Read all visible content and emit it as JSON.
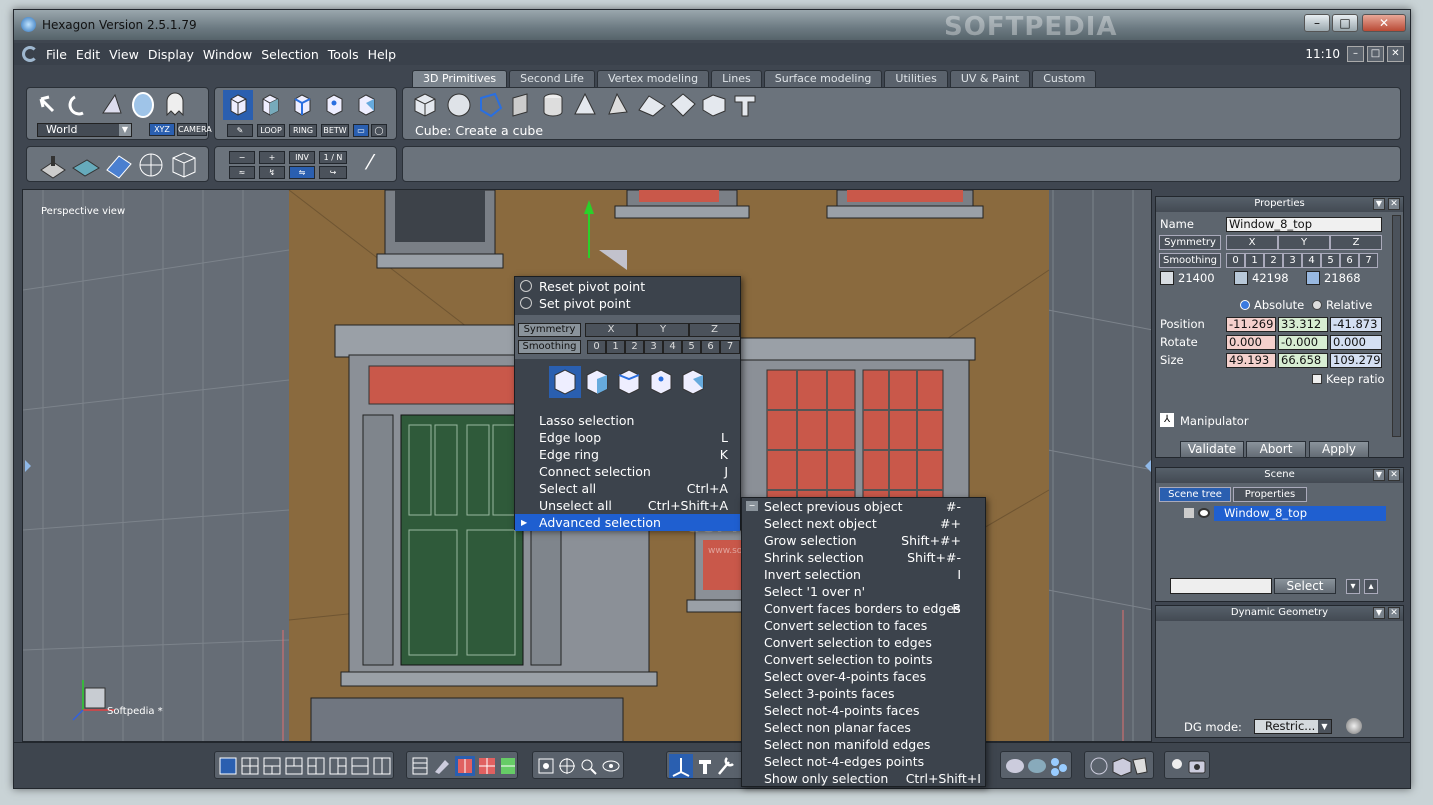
{
  "window": {
    "title": "Hexagon Version 2.5.1.79",
    "watermark": "SOFTPEDIA",
    "clock": "11:10"
  },
  "menu": [
    "File",
    "Edit",
    "View",
    "Display",
    "Window",
    "Selection",
    "Tools",
    "Help"
  ],
  "tabs": [
    "3D Primitives",
    "Second Life",
    "Vertex modeling",
    "Lines",
    "Surface modeling",
    "Utilities",
    "UV & Paint",
    "Custom"
  ],
  "toolbar": {
    "coord_select": "World",
    "xyz_label": "XYZ",
    "camera_label": "CAMERA",
    "loop_label": "LOOP",
    "ring_label": "RING",
    "betw_label": "BETW",
    "minus_label": "−",
    "plus_label": "+",
    "inv_label": "INV",
    "one_n_label": "1 / N",
    "hint": "Cube: Create a cube"
  },
  "viewport": {
    "label": "Perspective view",
    "axis_label": "Softpedia *",
    "url_watermark": "www.softpedia.com"
  },
  "context_menu": {
    "top_items": [
      "Reset pivot point",
      "Set pivot point"
    ],
    "symmetry_label": "Symmetry",
    "axes": [
      "X",
      "Y",
      "Z"
    ],
    "smoothing_label": "Smoothing",
    "levels": [
      "0",
      "1",
      "2",
      "3",
      "4",
      "5",
      "6",
      "7"
    ],
    "items": [
      {
        "label": "Lasso selection",
        "key": ""
      },
      {
        "label": "Edge loop",
        "key": "L"
      },
      {
        "label": "Edge ring",
        "key": "K"
      },
      {
        "label": "Connect selection",
        "key": "J"
      },
      {
        "label": "Select all",
        "key": "Ctrl+A"
      },
      {
        "label": "Unselect all",
        "key": "Ctrl+Shift+A"
      },
      {
        "label": "Advanced selection",
        "key": ""
      }
    ]
  },
  "submenu": {
    "items": [
      {
        "label": "Select previous object",
        "key": "#-"
      },
      {
        "label": "Select next object",
        "key": "#+"
      },
      {
        "label": "Grow selection",
        "key": "Shift+#+"
      },
      {
        "label": "Shrink selection",
        "key": "Shift+#-"
      },
      {
        "label": "Invert selection",
        "key": "I"
      },
      {
        "label": "Select '1 over n'",
        "key": ""
      },
      {
        "label": "Convert faces borders to edges",
        "key": "B"
      },
      {
        "label": "Convert selection to faces",
        "key": ""
      },
      {
        "label": "Convert selection to edges",
        "key": ""
      },
      {
        "label": "Convert selection to points",
        "key": ""
      },
      {
        "label": "Select over-4-points faces",
        "key": ""
      },
      {
        "label": "Select 3-points faces",
        "key": ""
      },
      {
        "label": "Select not-4-points faces",
        "key": ""
      },
      {
        "label": "Select non planar faces",
        "key": ""
      },
      {
        "label": "Select non manifold edges",
        "key": ""
      },
      {
        "label": "Select not-4-edges points",
        "key": ""
      },
      {
        "label": "Show only selection",
        "key": "Ctrl+Shift+I"
      }
    ]
  },
  "properties": {
    "title": "Properties",
    "name_label": "Name",
    "name_value": "Window_8_top",
    "symmetry_label": "Symmetry",
    "axes": [
      "X",
      "Y",
      "Z"
    ],
    "smoothing_label": "Smoothing",
    "levels": [
      "0",
      "1",
      "2",
      "3",
      "4",
      "5",
      "6",
      "7"
    ],
    "counts": [
      "21400",
      "42198",
      "21868"
    ],
    "absolute_label": "Absolute",
    "relative_label": "Relative",
    "position_label": "Position",
    "position": [
      "-11.269",
      "33.312",
      "-41.873"
    ],
    "rotate_label": "Rotate",
    "rotate": [
      "0.000",
      "-0.000",
      "0.000"
    ],
    "size_label": "Size",
    "size": [
      "49.193",
      "66.658",
      "109.279"
    ],
    "keep_ratio_label": "Keep ratio",
    "manipulator_label": "Manipulator",
    "validate_label": "Validate",
    "abort_label": "Abort",
    "apply_label": "Apply"
  },
  "scene": {
    "title": "Scene",
    "tab_tree": "Scene tree",
    "tab_props": "Properties",
    "item": "Window_8_top",
    "select_label": "Select"
  },
  "dynamic": {
    "title": "Dynamic Geometry",
    "mode_label": "DG mode:",
    "mode_value": "Restric..."
  },
  "colors": {
    "accent": "#1f5fd0",
    "wall": "#8a6a3e",
    "brick_window": "#c9584a",
    "door": "#2f5a3a",
    "field_red": "#f4d0cc",
    "field_green": "#d7edd2",
    "field_blue": "#d4dff2"
  }
}
